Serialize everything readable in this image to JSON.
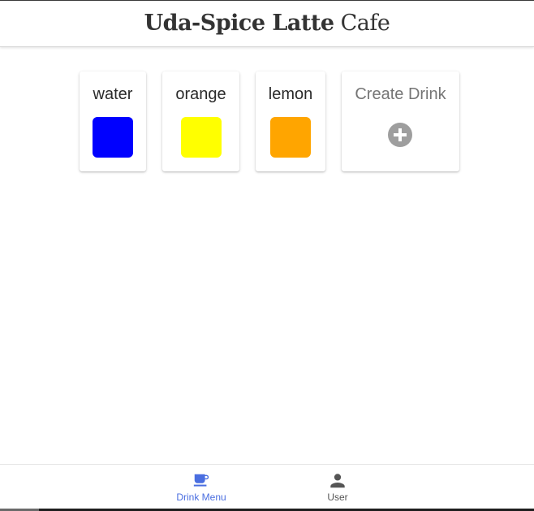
{
  "header": {
    "title_bold": "Uda-Spice Latte",
    "title_light": "Cafe"
  },
  "drinks": [
    {
      "name": "water",
      "color": "#0000ff"
    },
    {
      "name": "orange",
      "color": "#ffff00"
    },
    {
      "name": "lemon",
      "color": "#ffa500"
    }
  ],
  "create_card": {
    "label": "Create Drink",
    "icon": "add-circle-icon"
  },
  "bottom_nav": {
    "items": [
      {
        "label": "Drink Menu",
        "icon": "coffee-icon",
        "active": true
      },
      {
        "label": "User",
        "icon": "person-icon",
        "active": false
      }
    ],
    "active_color": "#4a6ee0",
    "inactive_color": "#555555"
  }
}
